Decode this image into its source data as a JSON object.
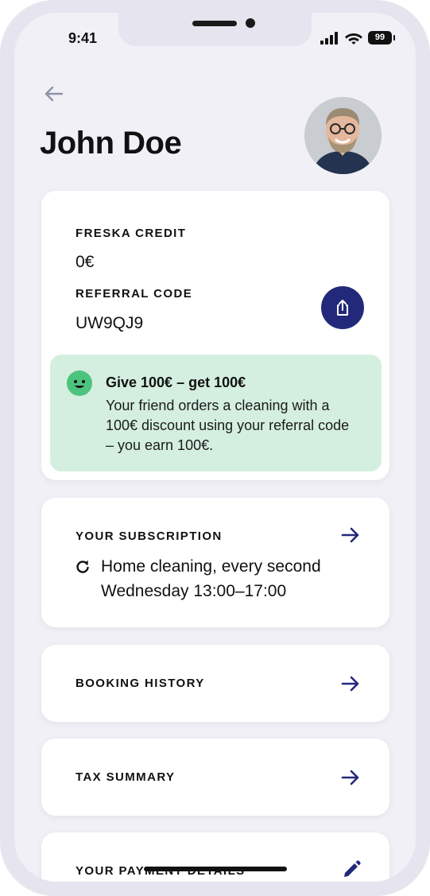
{
  "status_bar": {
    "time": "9:41",
    "battery": "99"
  },
  "header": {
    "title": "John Doe"
  },
  "credit": {
    "credit_label": "FRESKA CREDIT",
    "credit_value": "0€",
    "referral_label": "REFERRAL CODE",
    "referral_code": "UW9QJ9"
  },
  "promo": {
    "title": "Give 100€ – get 100€",
    "text": "Your friend orders a cleaning with a 100€ discount using your referral code – you earn 100€."
  },
  "subscription": {
    "label": "YOUR SUBSCRIPTION",
    "text": "Home cleaning, every second Wednesday 13:00–17:00"
  },
  "booking_history": {
    "label": "BOOKING HISTORY"
  },
  "tax_summary": {
    "label": "TAX SUMMARY"
  },
  "payment_details": {
    "label": "YOUR PAYMENT DETAILS"
  },
  "icons": {
    "back": "arrow-left-icon",
    "share": "share-icon",
    "smiley": "smiley-icon",
    "refresh": "refresh-icon",
    "arrow": "arrow-right-icon",
    "edit": "pencil-icon"
  },
  "colors": {
    "accent": "#23297a",
    "promo_background": "#d4efdf",
    "smiley": "#4cc47d",
    "screen_background": "#f1f0f6"
  }
}
